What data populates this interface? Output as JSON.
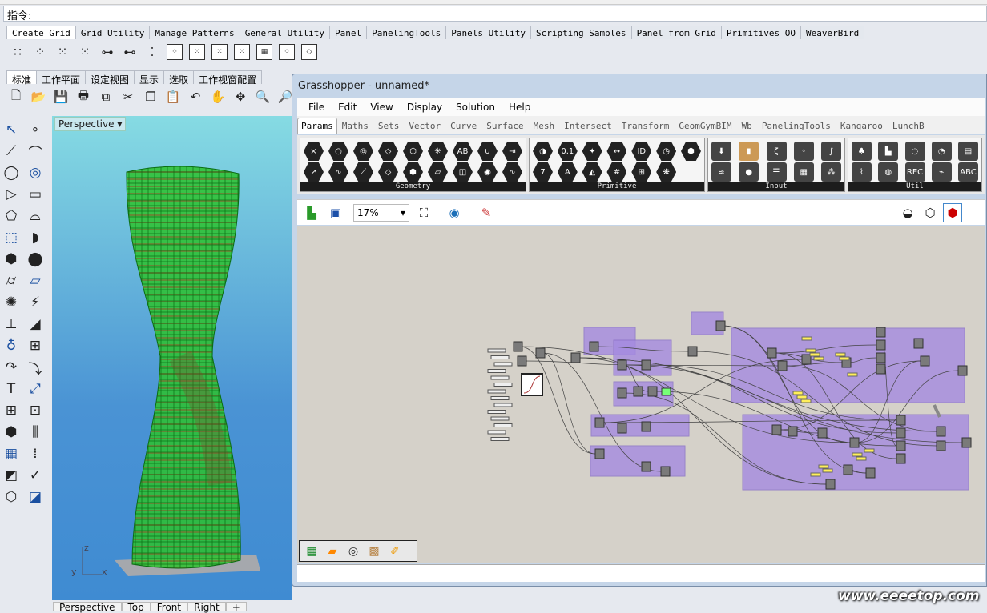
{
  "command_prompt": "指令:",
  "rhino_tabs": [
    "Create Grid",
    "Grid Utility",
    "Manage Patterns",
    "General Utility",
    "Panel",
    "PanelingTools",
    "Panels Utility",
    "Scripting Samples",
    "Panel from Grid",
    "Primitives OO",
    "WeaverBird"
  ],
  "rhino_std_tabs": [
    "标准",
    "工作平面",
    "设定视图",
    "显示",
    "选取",
    "工作视窗配置"
  ],
  "viewport": {
    "label": "Perspective",
    "axes": {
      "z": "z",
      "x": "x",
      "y": "y"
    },
    "tabs": [
      "Perspective",
      "Top",
      "Front",
      "Right",
      "+"
    ]
  },
  "grasshopper": {
    "title": "Grasshopper - unnamed*",
    "menu": [
      "File",
      "Edit",
      "View",
      "Display",
      "Solution",
      "Help"
    ],
    "tabs": [
      "Params",
      "Maths",
      "Sets",
      "Vector",
      "Curve",
      "Surface",
      "Mesh",
      "Intersect",
      "Transform",
      "GeomGymBIM",
      "Wb",
      "PanelingTools",
      "Kangaroo",
      "LunchB"
    ],
    "active_tab": "Params",
    "palettes": [
      {
        "name": "Geometry",
        "icons": [
          "×",
          "○",
          "◎",
          "◇",
          "⬡",
          "✳",
          "AB",
          "∪",
          "⇥",
          "↗",
          "∿",
          "⟋",
          "◇",
          "⬢",
          "▱",
          "◫",
          "◉",
          "∿"
        ]
      },
      {
        "name": "Primitive",
        "icons": [
          "◑",
          "0.1",
          "✦",
          "↔",
          "ID",
          "◷",
          "⬢",
          "7",
          "A",
          "◭",
          "#",
          "⊞",
          "❋"
        ]
      },
      {
        "name": "Input",
        "icons": [
          "⬇",
          "▮",
          "ζ",
          "◦",
          "∫",
          "≋",
          "●",
          "☰",
          "▦",
          "⁂"
        ]
      },
      {
        "name": "Util",
        "icons": [
          "♣",
          "▙",
          "◌",
          "◔",
          "▤",
          "⌇",
          "◍",
          "REC",
          "⌁",
          "ABC"
        ]
      }
    ],
    "zoom": "17%",
    "status": "_",
    "accent_group_color": "#a58be0"
  },
  "watermark": "www.eeeetop.com"
}
